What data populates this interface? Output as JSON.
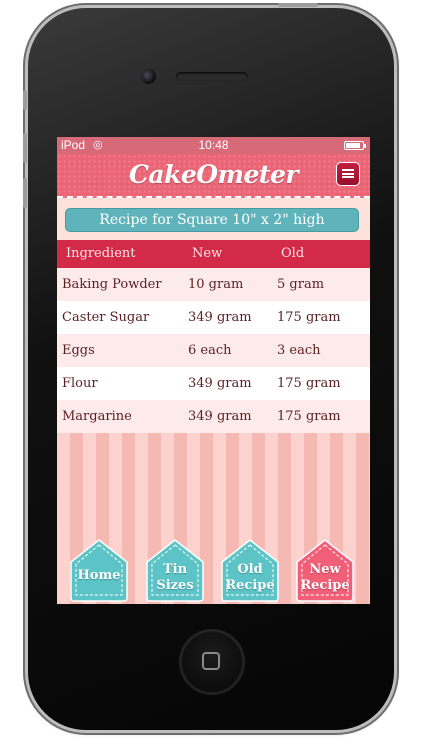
{
  "status_bar": {
    "carrier": "iPod",
    "time": "10:48",
    "battery_level": 0.9
  },
  "nav_bar": {
    "title": "CakeOmeter",
    "menu_icon": "menu-icon"
  },
  "recipe_banner": "Recipe for Square 10\" x 2\" high",
  "table": {
    "headers": [
      "Ingredient",
      "New",
      "Old"
    ],
    "rows": [
      [
        "Baking Powder",
        "10 gram",
        "5 gram"
      ],
      [
        "Caster Sugar",
        "349 gram",
        "175 gram"
      ],
      [
        "Eggs",
        "6 each",
        "3 each"
      ],
      [
        "Flour",
        "349 gram",
        "175 gram"
      ],
      [
        "Margarine",
        "349 gram",
        "175 gram"
      ]
    ]
  },
  "bottom_buttons": [
    {
      "label1": "Home",
      "label2": "",
      "color": "#5cc3c6"
    },
    {
      "label1": "Tin",
      "label2": "Sizes",
      "color": "#5cc3c6"
    },
    {
      "label1": "Old",
      "label2": "Recipe",
      "color": "#5cc3c6"
    },
    {
      "label1": "New",
      "label2": "Recipe",
      "color": "#f05e78"
    }
  ],
  "colors": {
    "nav_pink": "#ea6677",
    "header_red": "#d42a4a",
    "banner_teal": "#5fb4bb"
  }
}
